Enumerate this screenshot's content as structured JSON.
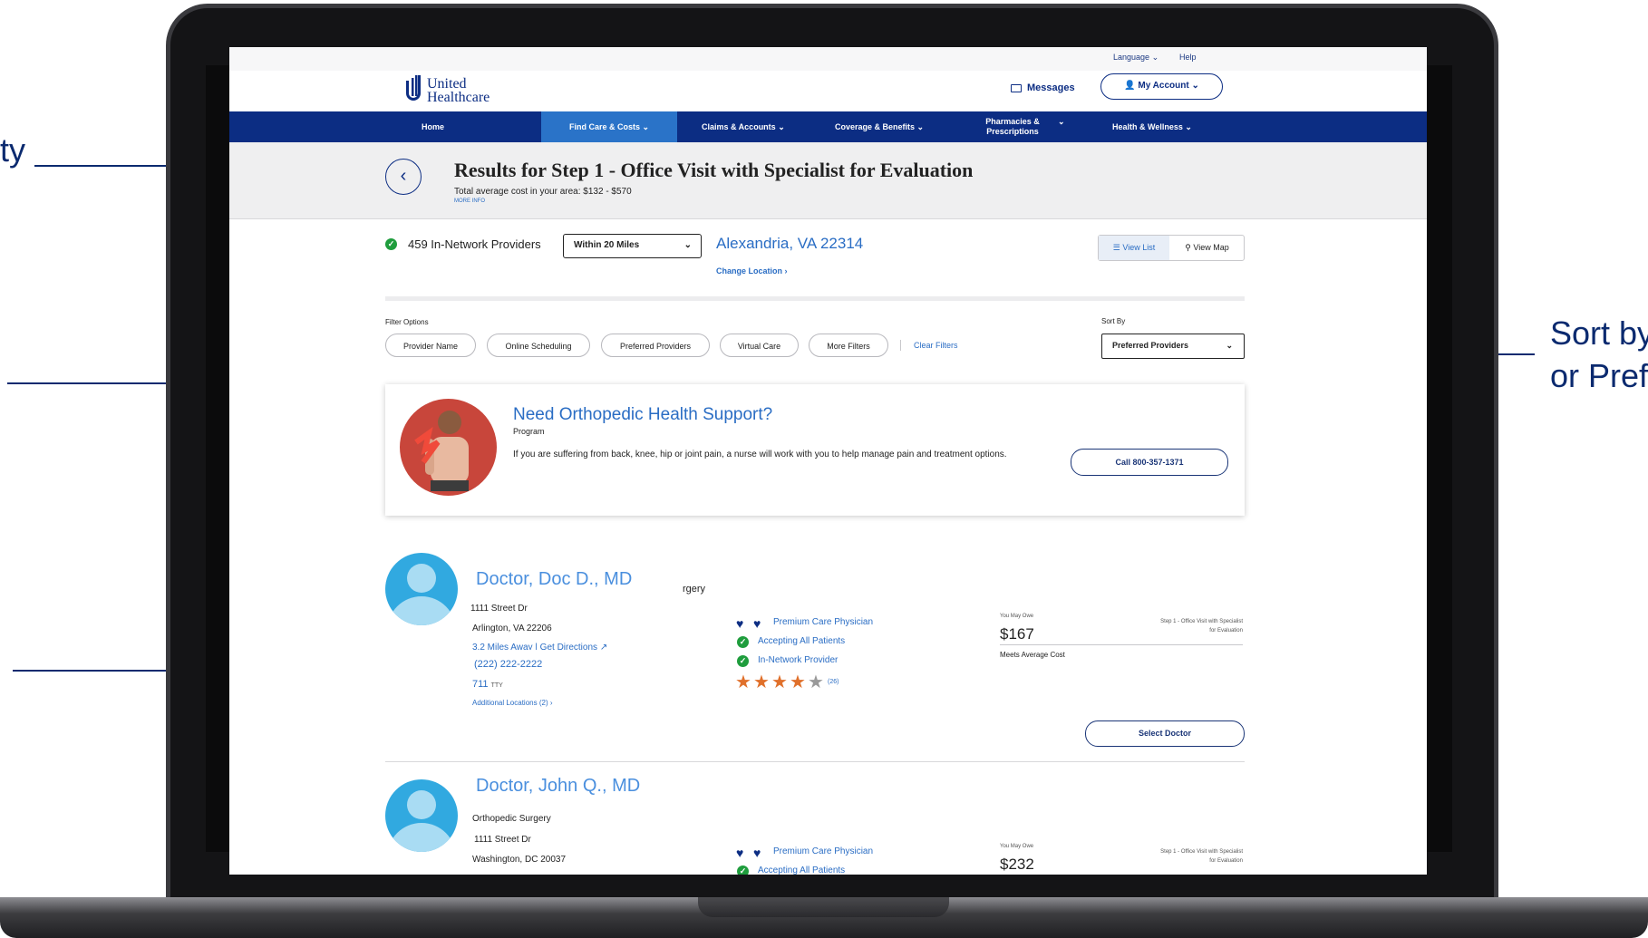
{
  "callouts": {
    "left_top_fragment": "ty",
    "right_line1": "Sort by",
    "right_line2": "or Pref"
  },
  "topbar": {
    "language": "Language",
    "help": "Help"
  },
  "header": {
    "logo_line1": "United",
    "logo_line2": "Healthcare",
    "messages": "Messages",
    "my_account": "My Account"
  },
  "nav": {
    "home": "Home",
    "find_care": "Find Care & Costs",
    "claims": "Claims & Accounts",
    "coverage": "Coverage & Benefits",
    "pharmacies_line1": "Pharmacies &",
    "pharmacies_line2": "Prescriptions",
    "health": "Health & Wellness"
  },
  "results": {
    "title": "Results for Step 1 - Office Visit with Specialist for Evaluation",
    "avg_cost": "Total average cost in your area: $132 - $570",
    "more_info": "MORE INFO"
  },
  "summary": {
    "provider_count": "459 In-Network Providers",
    "distance": "Within 20 Miles",
    "location": "Alexandria, VA 22314",
    "change_location": "Change Location",
    "view_list": "View List",
    "view_map": "View Map"
  },
  "filters": {
    "label": "Filter Options",
    "provider_name": "Provider Name",
    "online_scheduling": "Online Scheduling",
    "preferred_providers": "Preferred Providers",
    "virtual_care": "Virtual Care",
    "more_filters": "More Filters",
    "clear_filters": "Clear Filters",
    "sort_label": "Sort By",
    "sort_value": "Preferred Providers"
  },
  "program_card": {
    "title": "Need Orthopedic Health Support?",
    "subtitle": "Program",
    "description": "If you are suffering from back, knee, hip or joint pain, a nurse will work with you to help manage pain and treatment options.",
    "call_button": "Call 800-357-1371"
  },
  "doctors": [
    {
      "name": "Doctor, Doc D., MD",
      "specialty_fragment": "rgery",
      "street": "1111 Street Dr",
      "city": "Arlington, VA 22206",
      "distance": "3.2 Miles Away",
      "directions": "Get Directions",
      "phone": "(222) 222-2222",
      "tty": "711",
      "tty_label": "TTY",
      "additional_locations": "Additional Locations (2)",
      "badge_premium": "Premium Care Physician",
      "badge_accepting": "Accepting All Patients",
      "badge_network": "In-Network Provider",
      "rating": 4,
      "review_count": "(26)",
      "owe_label": "You May Owe",
      "owe_amount": "$167",
      "owe_note": "Meets Average Cost",
      "step_line1": "Step 1 - Office Visit with Specialist",
      "step_line2": "for Evaluation",
      "select_button": "Select Doctor"
    },
    {
      "name": "Doctor, John Q., MD",
      "specialty": "Orthopedic Surgery",
      "street": "1111 Street Dr",
      "city": "Washington, DC 20037",
      "badge_premium": "Premium Care Physician",
      "badge_accepting": "Accepting All Patients",
      "owe_label": "You May Owe",
      "owe_amount": "$232",
      "step_line1": "Step 1 - Office Visit with Specialist",
      "step_line2": "for Evaluation"
    }
  ],
  "colors": {
    "navy": "#0c2d83",
    "link_blue": "#2a6dc4",
    "active_nav": "#2a73c8",
    "callout": "#0b2a6f",
    "star": "#e0702b"
  },
  "icons": [
    "back-arrow-icon",
    "envelope-icon",
    "user-icon",
    "chevron-down-icon",
    "check-circle-icon",
    "list-icon",
    "map-pin-icon",
    "heart-icon",
    "star-icon",
    "external-link-icon"
  ]
}
